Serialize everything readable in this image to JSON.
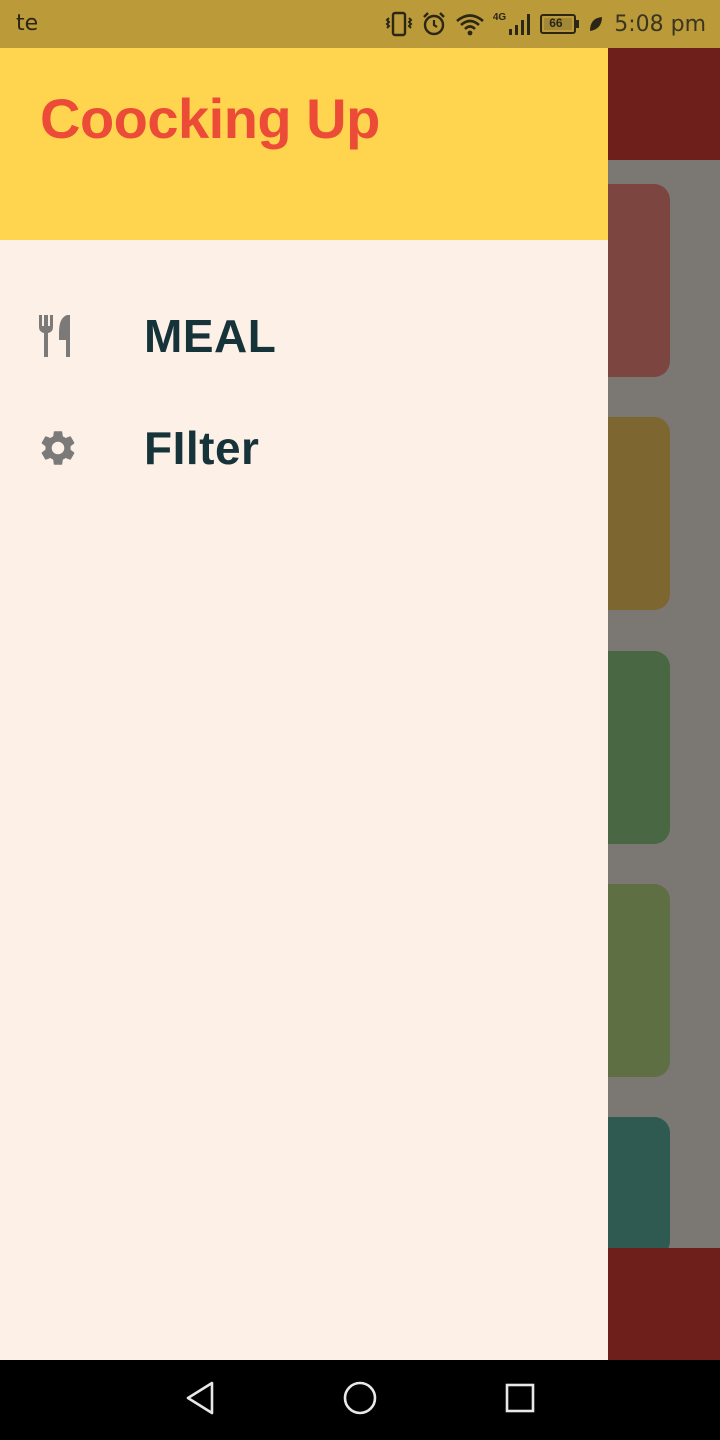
{
  "status_bar": {
    "carrier": "te",
    "network": "4G",
    "battery": "66",
    "time": "5:08 pm"
  },
  "drawer": {
    "title": "Coocking Up",
    "items": [
      {
        "label": "MEAL",
        "icon": "restaurant-icon"
      },
      {
        "label": "FIlter",
        "icon": "gear-icon"
      }
    ]
  },
  "colors": {
    "header_bg": "#ffd550",
    "title": "#ec4b37",
    "drawer_bg": "#fcf0e7",
    "item_text": "#17333a",
    "app_bar": "#6e1f1b"
  }
}
